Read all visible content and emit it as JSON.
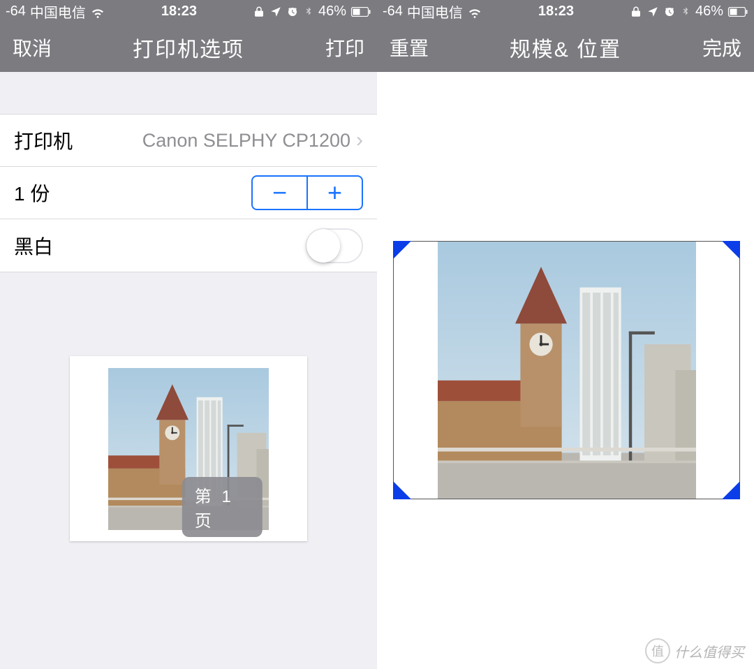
{
  "status": {
    "signal": "-64",
    "carrier": "中国电信",
    "time": "18:23",
    "battery_pct": "46%"
  },
  "left_screen": {
    "nav": {
      "cancel": "取消",
      "title": "打印机选项",
      "print": "打印"
    },
    "rows": {
      "printer_label": "打印机",
      "printer_value": "Canon SELPHY CP1200",
      "copies_label": "1 份",
      "bw_label": "黑白"
    },
    "page_badge": "第 1 页"
  },
  "right_screen": {
    "nav": {
      "reset": "重置",
      "title": "规模& 位置",
      "done": "完成"
    }
  },
  "watermark": {
    "badge": "值",
    "text": "什么值得买"
  }
}
